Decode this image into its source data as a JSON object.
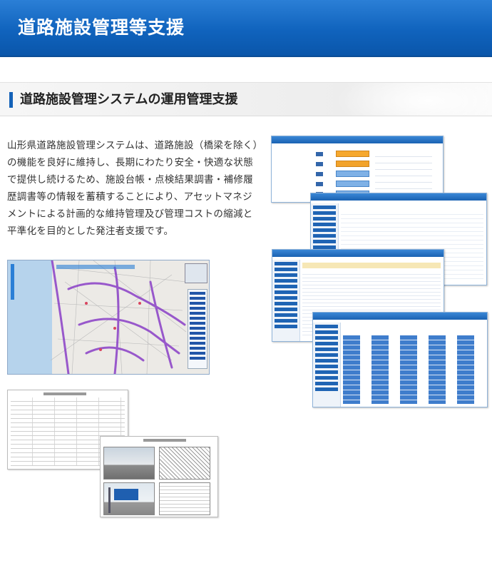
{
  "header": {
    "title": "道路施設管理等支援"
  },
  "section": {
    "title": "道路施設管理システムの運用管理支援"
  },
  "description": "山形県道路施設管理システムは、道路施設（橋梁を除く）の機能を良好に維持し、長期にわたり安全・快適な状態で提供し続けるため、施設台帳・点検結果調書・補修履歴調書等の情報を蓄積することにより、アセットマネジメントによる計画的な維持管理及び管理コストの縮減と平準化を目的とした発注者支援です。",
  "images": {
    "screens": "system-screenshots",
    "map": "road-facility-map",
    "documents": "inspection-record-documents"
  },
  "colors": {
    "header": "#1063bd",
    "accent": "#1462b8",
    "road": "#8a3fc7"
  }
}
